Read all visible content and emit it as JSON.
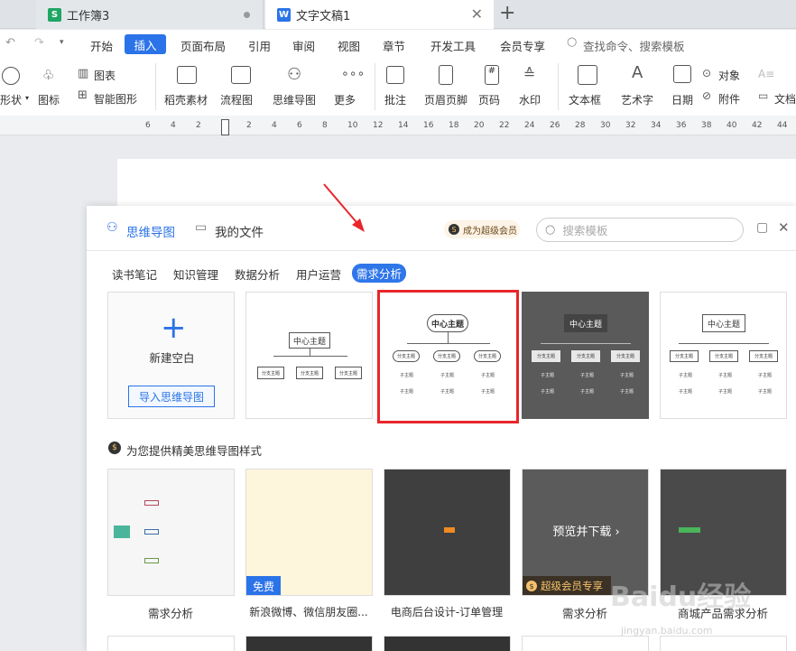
{
  "tabs": [
    {
      "label": "工作簿3",
      "icon": "S"
    },
    {
      "label": "文字文稿1",
      "icon": "W"
    }
  ],
  "menu": [
    "开始",
    "插入",
    "页面布局",
    "引用",
    "审阅",
    "视图",
    "章节",
    "开发工具",
    "会员专享"
  ],
  "search_cmd": "查找命令、搜索模板",
  "ribbon": {
    "shape": "形状",
    "icon_lib": "图标",
    "chart": "图表",
    "smartart": "智能图形",
    "docer": "稻壳素材",
    "flowchart": "流程图",
    "mindmap": "思维导图",
    "more": "更多",
    "comment": "批注",
    "header_footer": "页眉页脚",
    "page_no": "页码",
    "watermark": "水印",
    "textbox": "文本框",
    "wordart": "艺术字",
    "date": "日期",
    "object": "对象",
    "attachment": "附件",
    "doc": "文档"
  },
  "ruler": [
    "6",
    "4",
    "2",
    "2",
    "4",
    "6",
    "8",
    "10",
    "12",
    "14",
    "16",
    "18",
    "20",
    "22",
    "24",
    "26",
    "28",
    "30",
    "32",
    "34",
    "36",
    "38",
    "40",
    "42",
    "44"
  ],
  "dialog": {
    "title": "思维导图",
    "my_files": "我的文件",
    "vip": "成为超级会员",
    "search_placeholder": "搜索模板",
    "categories": [
      "读书笔记",
      "知识管理",
      "数据分析",
      "用户运营",
      "需求分析"
    ],
    "active_category": "需求分析",
    "new_blank": "新建空白",
    "import": "导入思维导图",
    "node_center": "中心主题",
    "node_branch": "分支主题",
    "node_sub": "子主题",
    "section_title": "为您提供精美思维导图样式",
    "free": "免费",
    "preview": "预览并下载",
    "super_vip": "超级会员专享",
    "gallery": [
      "需求分析",
      "新浪微博、微信朋友圈...",
      "电商后台设计-订单管理",
      "需求分析",
      "商城产品需求分析"
    ]
  },
  "watermark": {
    "brand": "Baidu经验",
    "url": "jingyan.baidu.com"
  },
  "colors": {
    "accent": "#2b73e8",
    "highlight": "#e8262b",
    "dark_card": "#5a5a5a"
  }
}
